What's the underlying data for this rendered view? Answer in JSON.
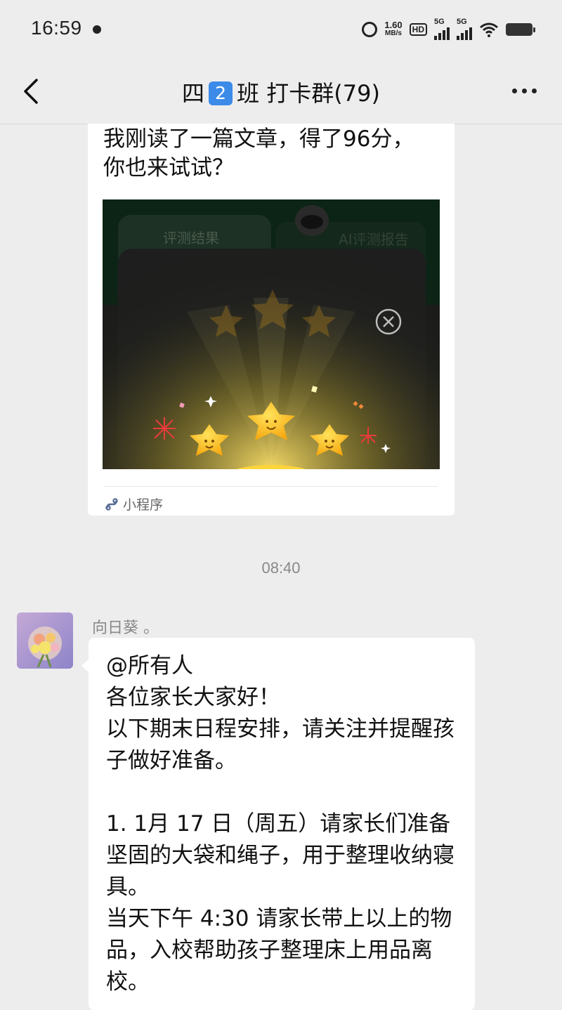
{
  "status_bar": {
    "time": "16:59",
    "net_speed_value": "1.60",
    "net_speed_unit": "MB/s",
    "hd_label": "HD",
    "signal1_label": "5G",
    "signal2_label": "5G"
  },
  "nav": {
    "title_prefix": "四",
    "title_keycap": "2",
    "title_suffix": "班 打卡群(79)"
  },
  "shared_card": {
    "text": "我刚读了一篇文章，得了96分，\n你也来试试？",
    "thumbnail": {
      "tab_left": "评测结果",
      "tab_right": "AI评测报告",
      "stars_earned": 3
    },
    "footer_label": "小程序"
  },
  "timestamp": "08:40",
  "message": {
    "sender": "向日葵 。",
    "text": "@所有人\n各位家长大家好！\n以下期末日程安排，请关注并提醒孩子做好准备。\n\n1. 1月 17 日（周五）请家长们准备坚固的大袋和绳子，用于整理收纳寝具。\n当天下午 4:30 请家长带上以上的物品，入校帮助孩子整理床上用品离校。"
  },
  "colors": {
    "background": "#ededed",
    "bubble": "#ffffff",
    "link_blue": "#576b95",
    "keycap_blue": "#3d8be8",
    "star_gold": "#ffc21a"
  }
}
